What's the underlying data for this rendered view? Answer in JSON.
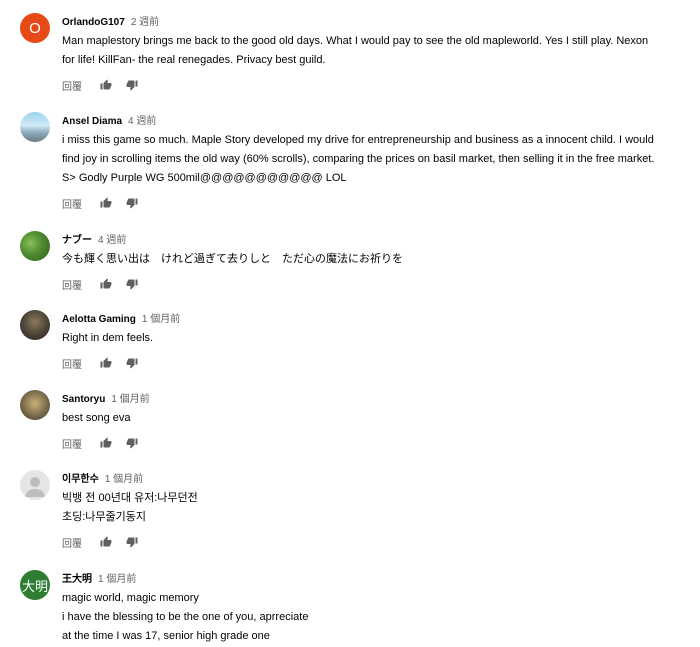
{
  "reply_label": "回覆",
  "comments": [
    {
      "author": "OrlandoG107",
      "time": "2 週前",
      "avatar_letter": "O",
      "lines": [
        "Man maplestory brings me back to the good old days. What I would pay to see the old mapleworld. Yes I still play. Nexon",
        "for life! KillFan- the real renegades. Privacy best guild."
      ]
    },
    {
      "author": "Ansel Diama",
      "time": "4 週前",
      "avatar_letter": "",
      "lines": [
        "i miss this game so much. Maple Story developed my drive for entrepreneurship and business as a innocent child. I would",
        "find joy in scrolling items the old way (60% scrolls), comparing the prices on basil market, then selling it in the free market.",
        "S> Godly Purple WG 500mil@@@@@@@@@@@ LOL"
      ]
    },
    {
      "author": "ナブー",
      "time": "4 週前",
      "avatar_letter": "",
      "lines": [
        "今も輝く思い出は　けれど過ぎて去りしと　ただ心の魔法にお祈りを"
      ]
    },
    {
      "author": "Aelotta Gaming",
      "time": "1 個月前",
      "avatar_letter": "",
      "lines": [
        "Right in dem feels."
      ]
    },
    {
      "author": "Santoryu",
      "time": "1 個月前",
      "avatar_letter": "",
      "lines": [
        "best song eva"
      ]
    },
    {
      "author": "이무한수",
      "time": "1 個月前",
      "avatar_letter": "",
      "lines": [
        "빅뱅 전 00년대 유저:나무던전",
        "초딩:나무줄기동지"
      ]
    },
    {
      "author": "王大明",
      "time": "1 個月前",
      "avatar_letter": "大明",
      "lines": [
        "magic world, magic memory",
        "i have the blessing to be the one of you, aprreciate",
        "at the time I was 17, senior high grade one"
      ]
    }
  ],
  "colors": {
    "author": "#030303",
    "meta": "#606060",
    "avatar_o": "#e64a19",
    "avatar_wangdaming": "#2e7d32"
  }
}
